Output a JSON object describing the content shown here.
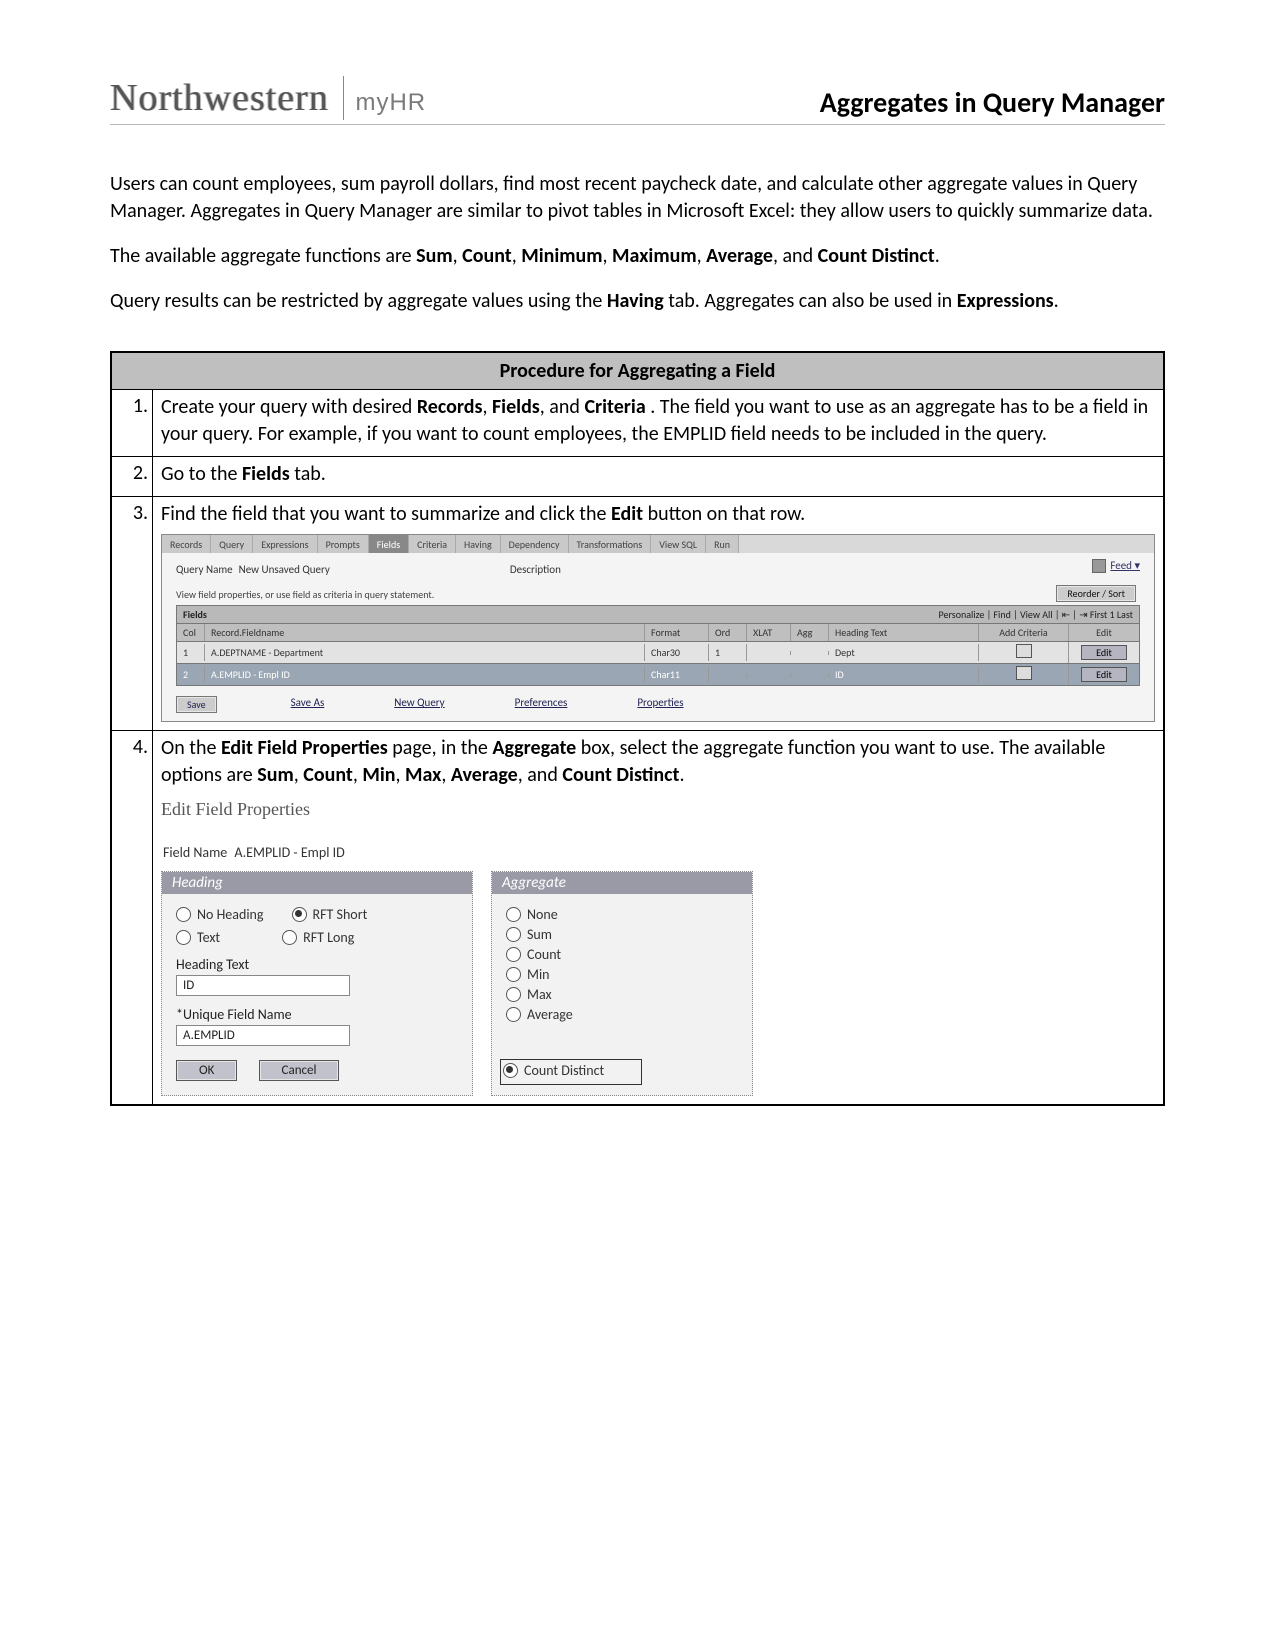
{
  "header": {
    "brand": "Northwestern",
    "subbrand": "myHR",
    "title": "Aggregates in Query Manager"
  },
  "intro": {
    "p1": "Users can count employees, sum payroll dollars, find most recent paycheck date, and calculate other aggregate values in Query Manager. Aggregates in Query Manager are similar to pivot tables in Microsoft Excel: they allow users to quickly summarize data.",
    "p2_pre": "The available aggregate functions are ",
    "p2_funcs": [
      "Sum",
      "Count",
      "Minimum",
      "Maximum",
      "Average",
      "Count Distinct"
    ],
    "p2_post": ".",
    "p3_a": "Query results can be restricted by aggregate values using the ",
    "p3_b": "Having",
    "p3_c": " tab. Aggregates can also be used in ",
    "p3_d": "Expressions",
    "p3_e": "."
  },
  "procedure": {
    "heading": "Procedure for Aggregating a Field",
    "steps": [
      {
        "n": "1.",
        "text_a": "Create your query with desired ",
        "b1": "Records",
        "c1": ", ",
        "b2": "Fields",
        "c2": ", and ",
        "b3": "Criteria",
        "text_b": ". The field you want to use as an aggregate has to be a field in your query. For example, if you want to count employees, the EMPLID field needs to be included in the query."
      },
      {
        "n": "2.",
        "text_a": "Go to the ",
        "b1": "Fields",
        "text_b": " tab."
      },
      {
        "n": "3.",
        "text_a": "Find the field that you want to summarize and click the ",
        "b1": "Edit",
        "text_b": " button on that row."
      },
      {
        "n": "4.",
        "text_a": "On the ",
        "b1": "Edit Field Properties",
        "c1": " page, in the ",
        "b2": "Aggregate",
        "c2": " box, select the aggregate function you want to use. The available options are ",
        "b3": "Sum",
        "c3": ", ",
        "b4": "Count",
        "c4": ", ",
        "b5": "Min",
        "c5": ", ",
        "b6": "Max",
        "c6": ", ",
        "b7": "Average",
        "c7": ", and ",
        "b8": "Count Distinct",
        "text_b": "."
      }
    ]
  },
  "qm": {
    "tabs": [
      "Records",
      "Query",
      "Expressions",
      "Prompts",
      "Fields",
      "Criteria",
      "Having",
      "Dependency",
      "Transformations",
      "View SQL",
      "Run"
    ],
    "active_tab_index": 4,
    "query_name_label": "Query Name",
    "query_name_value": "New Unsaved Query",
    "description_label": "Description",
    "hint": "View field properties, or use field as criteria in query statement.",
    "reorder_btn": "Reorder / Sort",
    "feed": "Feed",
    "feed_caret": "▾",
    "section_title": "Fields",
    "section_right": "Personalize | Find | View All | ⇤ | ⇥    First  1  Last",
    "grid_headers": {
      "col": "Col",
      "rec": "Record.Fieldname",
      "fmt": "Format",
      "ord": "Ord",
      "xlat": "XLAT",
      "agg": "Agg",
      "hdg": "Heading Text",
      "crit": "Add Criteria",
      "edit": "Edit"
    },
    "rows": [
      {
        "col": "1",
        "rec": "A.DEPTNAME - Department",
        "fmt": "Char30",
        "ord": "1",
        "xlat": "",
        "agg": "",
        "hdg": "Dept",
        "edit": "Edit",
        "sel": false
      },
      {
        "col": "2",
        "rec": "A.EMPLID - Empl ID",
        "fmt": "Char11",
        "ord": "",
        "xlat": "",
        "agg": "",
        "hdg": "ID",
        "edit": "Edit",
        "sel": true
      }
    ],
    "foot": {
      "save": "Save",
      "saveas": "Save As",
      "newq": "New Query",
      "prefs": "Preferences",
      "props": "Properties"
    }
  },
  "efp": {
    "title": "Edit Field Properties",
    "fieldname_label": "Field Name",
    "fieldname_value": "A.EMPLID - Empl ID",
    "heading_panel": "Heading",
    "aggregate_panel": "Aggregate",
    "heading_opts": [
      "No Heading",
      "RFT Short",
      "Text",
      "RFT Long"
    ],
    "heading_selected": 1,
    "heading_text_label": "Heading Text",
    "heading_text_value": "ID",
    "unique_label": "*Unique Field Name",
    "unique_value": "A.EMPLID",
    "agg_opts": [
      "None",
      "Sum",
      "Count",
      "Min",
      "Max",
      "Average",
      "Count Distinct"
    ],
    "agg_selected": 6,
    "ok": "OK",
    "cancel": "Cancel"
  }
}
